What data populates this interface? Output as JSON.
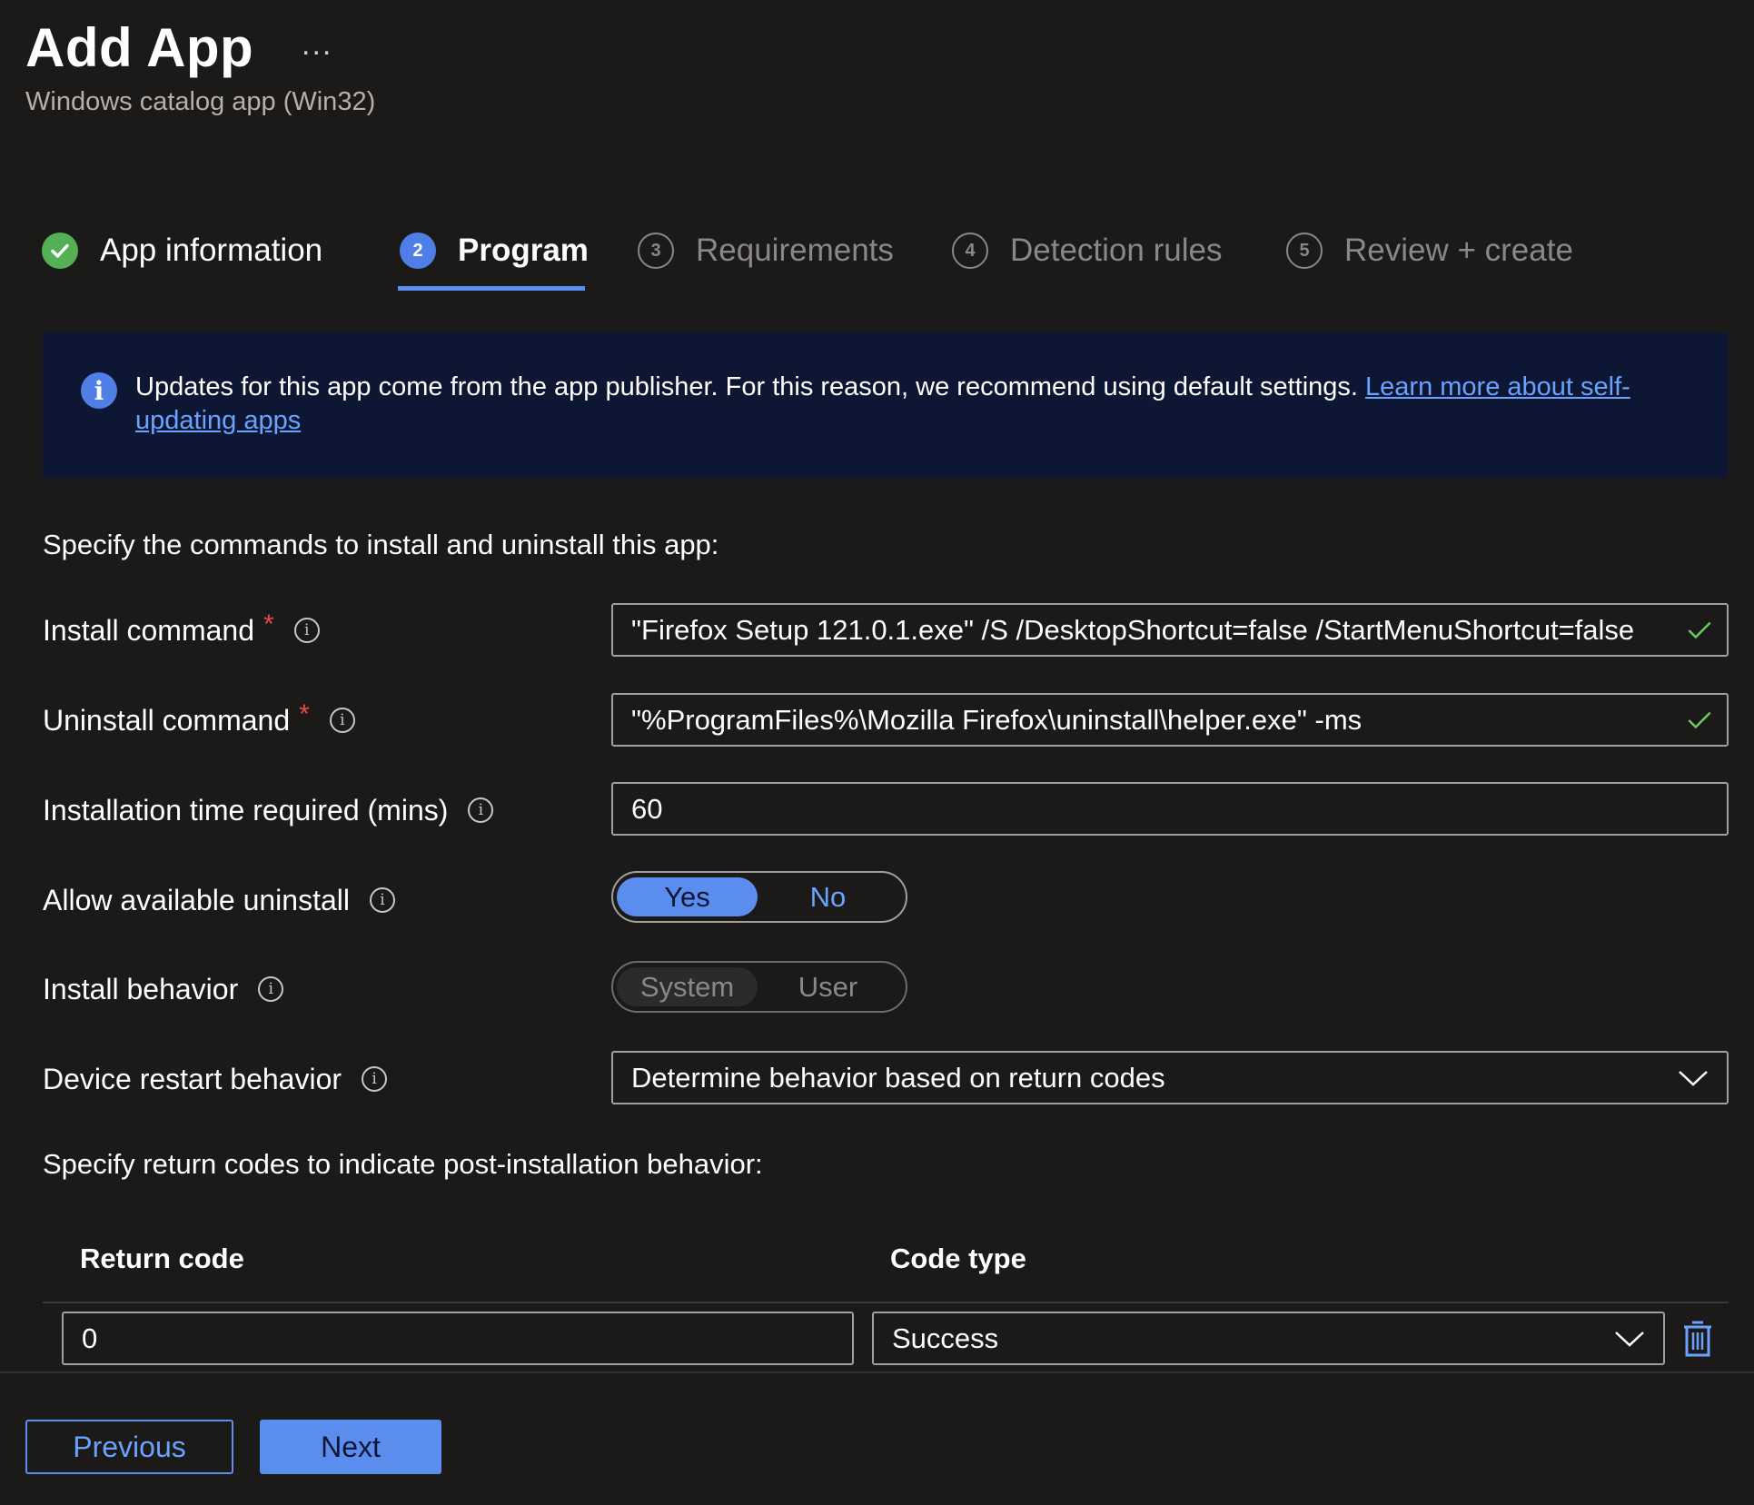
{
  "header": {
    "title": "Add App",
    "more_label": "...",
    "subtitle": "Windows catalog app (Win32)"
  },
  "tabs": [
    {
      "number": "",
      "label": "App information",
      "state": "done"
    },
    {
      "number": "2",
      "label": "Program",
      "state": "active"
    },
    {
      "number": "3",
      "label": "Requirements",
      "state": "pending"
    },
    {
      "number": "4",
      "label": "Detection rules",
      "state": "pending"
    },
    {
      "number": "5",
      "label": "Review + create",
      "state": "pending"
    }
  ],
  "banner": {
    "text": "Updates for this app come from the app publisher. For this reason, we recommend using default settings. ",
    "link": "Learn more about self-updating apps"
  },
  "form": {
    "intro": "Specify the commands to install and uninstall this app:",
    "install_command": {
      "label": "Install command",
      "required_mark": "*",
      "value": "\"Firefox Setup 121.0.1.exe\" /S /DesktopShortcut=false /StartMenuShortcut=false"
    },
    "uninstall_command": {
      "label": "Uninstall command",
      "required_mark": "*",
      "value": "\"%ProgramFiles%\\Mozilla Firefox\\uninstall\\helper.exe\" -ms"
    },
    "install_time": {
      "label": "Installation time required (mins)",
      "value": "60"
    },
    "allow_uninstall": {
      "label": "Allow available uninstall",
      "options": [
        "Yes",
        "No"
      ],
      "selected": "Yes"
    },
    "install_behavior": {
      "label": "Install behavior",
      "options": [
        "System",
        "User"
      ],
      "selected": "System"
    },
    "restart_behavior": {
      "label": "Device restart behavior",
      "value": "Determine behavior based on return codes"
    },
    "return_codes_intro": "Specify return codes to indicate post-installation behavior:"
  },
  "return_codes": {
    "columns": [
      "Return code",
      "Code type"
    ],
    "rows": [
      {
        "code": "0",
        "type": "Success"
      }
    ]
  },
  "footer": {
    "previous_label": "Previous",
    "next_label": "Next"
  },
  "colors": {
    "background": "#1b1a19",
    "accent": "#5b8def",
    "success": "#54b054",
    "banner_bg": "#0d1733",
    "required": "#e04a4a"
  }
}
